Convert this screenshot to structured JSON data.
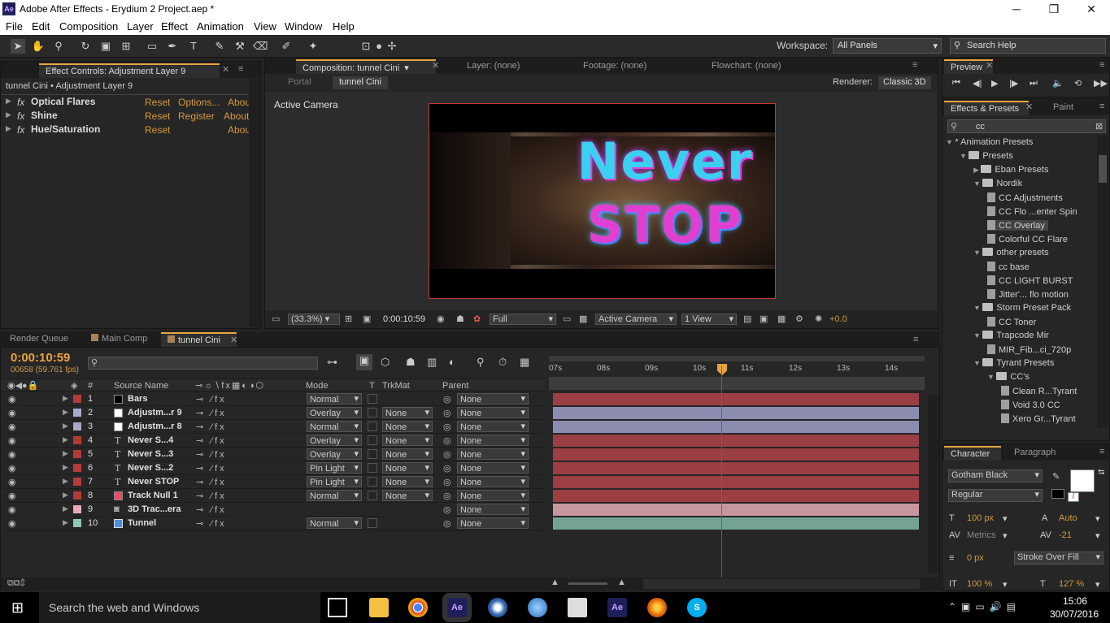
{
  "window": {
    "title": "Adobe After Effects - Erydium 2 Project.aep *",
    "logo": "Ae",
    "minimize": "─",
    "restore": "❐",
    "close": "✕"
  },
  "menu": [
    "File",
    "Edit",
    "Composition",
    "Layer",
    "Effect",
    "Animation",
    "View",
    "Window",
    "Help"
  ],
  "toolbar": {
    "workspace_label": "Workspace:",
    "workspace_value": "All Panels",
    "search_help": "Search Help"
  },
  "effect_controls": {
    "tab": "Effect Controls: Adjustment Layer 9",
    "subtitle": "tunnel Cini • Adjustment Layer 9",
    "effects": [
      {
        "name": "Optical Flares",
        "links": [
          "Reset",
          "Options...",
          "Abou"
        ]
      },
      {
        "name": "Shine",
        "links": [
          "Reset",
          "Register",
          "About"
        ]
      },
      {
        "name": "Hue/Saturation",
        "links": [
          "Reset",
          "",
          "Abou"
        ]
      }
    ]
  },
  "composition": {
    "tab": "Composition: tunnel Cini",
    "layer_tab": "Layer: (none)",
    "footage_tab": "Footage: (none)",
    "flowchart_tab": "Flowchart: (none)",
    "portal": "Portal",
    "comp_crumb": "tunnel Cini",
    "renderer_label": "Renderer:",
    "renderer_value": "Classic 3D",
    "active_camera": "Active Camera",
    "canvas_text_line1": "Never",
    "canvas_text_line2": "STOP",
    "zoom": "(33.3%)",
    "timecode": "0:00:10:59",
    "resolution": "Full",
    "camera": "Active Camera",
    "views": "1 View",
    "exposure": "+0.0"
  },
  "preview": {
    "tab": "Preview"
  },
  "effects_presets": {
    "tab": "Effects & Presets",
    "paint_tab": "Paint",
    "search": "cc",
    "tree": [
      {
        "label": "* Animation Presets",
        "depth": 0,
        "type": "root"
      },
      {
        "label": "Presets",
        "depth": 1,
        "type": "folder"
      },
      {
        "label": "Eban Presets",
        "depth": 2,
        "type": "folder"
      },
      {
        "label": "Nordik",
        "depth": 2,
        "type": "folder"
      },
      {
        "label": "CC Adjustments",
        "depth": 3,
        "type": "file"
      },
      {
        "label": "CC Flo ...enter Spin",
        "depth": 3,
        "type": "file"
      },
      {
        "label": "CC Overlay",
        "depth": 3,
        "type": "file",
        "selected": true
      },
      {
        "label": "Colorful CC Flare",
        "depth": 3,
        "type": "file"
      },
      {
        "label": "other presets",
        "depth": 2,
        "type": "folder"
      },
      {
        "label": "cc base",
        "depth": 3,
        "type": "file"
      },
      {
        "label": "CC LIGHT BURST",
        "depth": 3,
        "type": "file"
      },
      {
        "label": "Jitter'... flo motion",
        "depth": 3,
        "type": "file"
      },
      {
        "label": "Storm Preset Pack",
        "depth": 2,
        "type": "folder"
      },
      {
        "label": "CC Toner",
        "depth": 3,
        "type": "file"
      },
      {
        "label": "Trapcode Mir",
        "depth": 2,
        "type": "folder"
      },
      {
        "label": "MIR_Fib...ci_720p",
        "depth": 3,
        "type": "file"
      },
      {
        "label": "Tyrant Presets",
        "depth": 2,
        "type": "folder"
      },
      {
        "label": "CC's",
        "depth": 3,
        "type": "folder"
      },
      {
        "label": "Clean R...Tyrant",
        "depth": 4,
        "type": "file"
      },
      {
        "label": "Void 3.0 CC",
        "depth": 4,
        "type": "file"
      },
      {
        "label": "Xero Gr...Tyrant",
        "depth": 4,
        "type": "file"
      }
    ]
  },
  "character": {
    "tab": "Character",
    "paragraph_tab": "Paragraph",
    "font": "Gotham Black",
    "style": "Regular",
    "size": "100 px",
    "leading": "Auto",
    "kerning": "Metrics",
    "tracking": "-21",
    "stroke": "0 px",
    "stroke_mode": "Stroke Over Fill",
    "vscale": "100 %",
    "hscale": "127 %"
  },
  "timeline": {
    "tabs": [
      "Render Queue",
      "Main Comp",
      "tunnel Cini"
    ],
    "timecode": "0:00:10:59",
    "frame_info": "00658 (59.761 fps)",
    "col_source": "Source Name",
    "col_mode": "Mode",
    "col_t": "T",
    "col_trkmat": "TrkMat",
    "col_parent": "Parent",
    "ruler": [
      "07s",
      "08s",
      "09s",
      "10s",
      "11s",
      "12s",
      "13s",
      "14s"
    ],
    "layers": [
      {
        "num": "1",
        "name": "Bars",
        "mode": "Normal",
        "trkmat": "",
        "parent": "None",
        "color": "#b53a3a",
        "bar": "#9b3f44",
        "swatch": "#000000"
      },
      {
        "num": "2",
        "name": "Adjustm...r 9",
        "mode": "Overlay",
        "trkmat": "None",
        "parent": "None",
        "color": "#a9a9c9",
        "bar": "#8c8cb0",
        "swatch": "#ffffff"
      },
      {
        "num": "3",
        "name": "Adjustm...r 8",
        "mode": "Normal",
        "trkmat": "None",
        "parent": "None",
        "color": "#a9a9c9",
        "bar": "#8c8cb0",
        "swatch": "#ffffff"
      },
      {
        "num": "4",
        "name": "Never S...4",
        "mode": "Overlay",
        "trkmat": "None",
        "parent": "None",
        "color": "#b53a3a",
        "bar": "#9b3f44",
        "swatch": "T"
      },
      {
        "num": "5",
        "name": "Never S...3",
        "mode": "Overlay",
        "trkmat": "None",
        "parent": "None",
        "color": "#b53a3a",
        "bar": "#9b3f44",
        "swatch": "T"
      },
      {
        "num": "6",
        "name": "Never S...2",
        "mode": "Pin Light",
        "trkmat": "None",
        "parent": "None",
        "color": "#b53a3a",
        "bar": "#9b3f44",
        "swatch": "T"
      },
      {
        "num": "7",
        "name": "Never STOP",
        "mode": "Pin Light",
        "trkmat": "None",
        "parent": "None",
        "color": "#b53a3a",
        "bar": "#9b3f44",
        "swatch": "T"
      },
      {
        "num": "8",
        "name": "Track Null 1",
        "mode": "Normal",
        "trkmat": "None",
        "parent": "None",
        "color": "#b53a3a",
        "bar": "#9b3f44",
        "swatch": "#e84a6a"
      },
      {
        "num": "9",
        "name": "3D Trac...era",
        "mode": "",
        "trkmat": "",
        "parent": "None",
        "color": "#e8aab8",
        "bar": "#c8969e",
        "swatch": "cam"
      },
      {
        "num": "10",
        "name": "Tunnel",
        "mode": "Normal",
        "trkmat": "",
        "parent": "None",
        "color": "#8fc8b8",
        "bar": "#74a294",
        "swatch": "vid"
      }
    ]
  },
  "taskbar": {
    "search": "Search the web and Windows",
    "time": "15:06",
    "date": "30/07/2016"
  }
}
